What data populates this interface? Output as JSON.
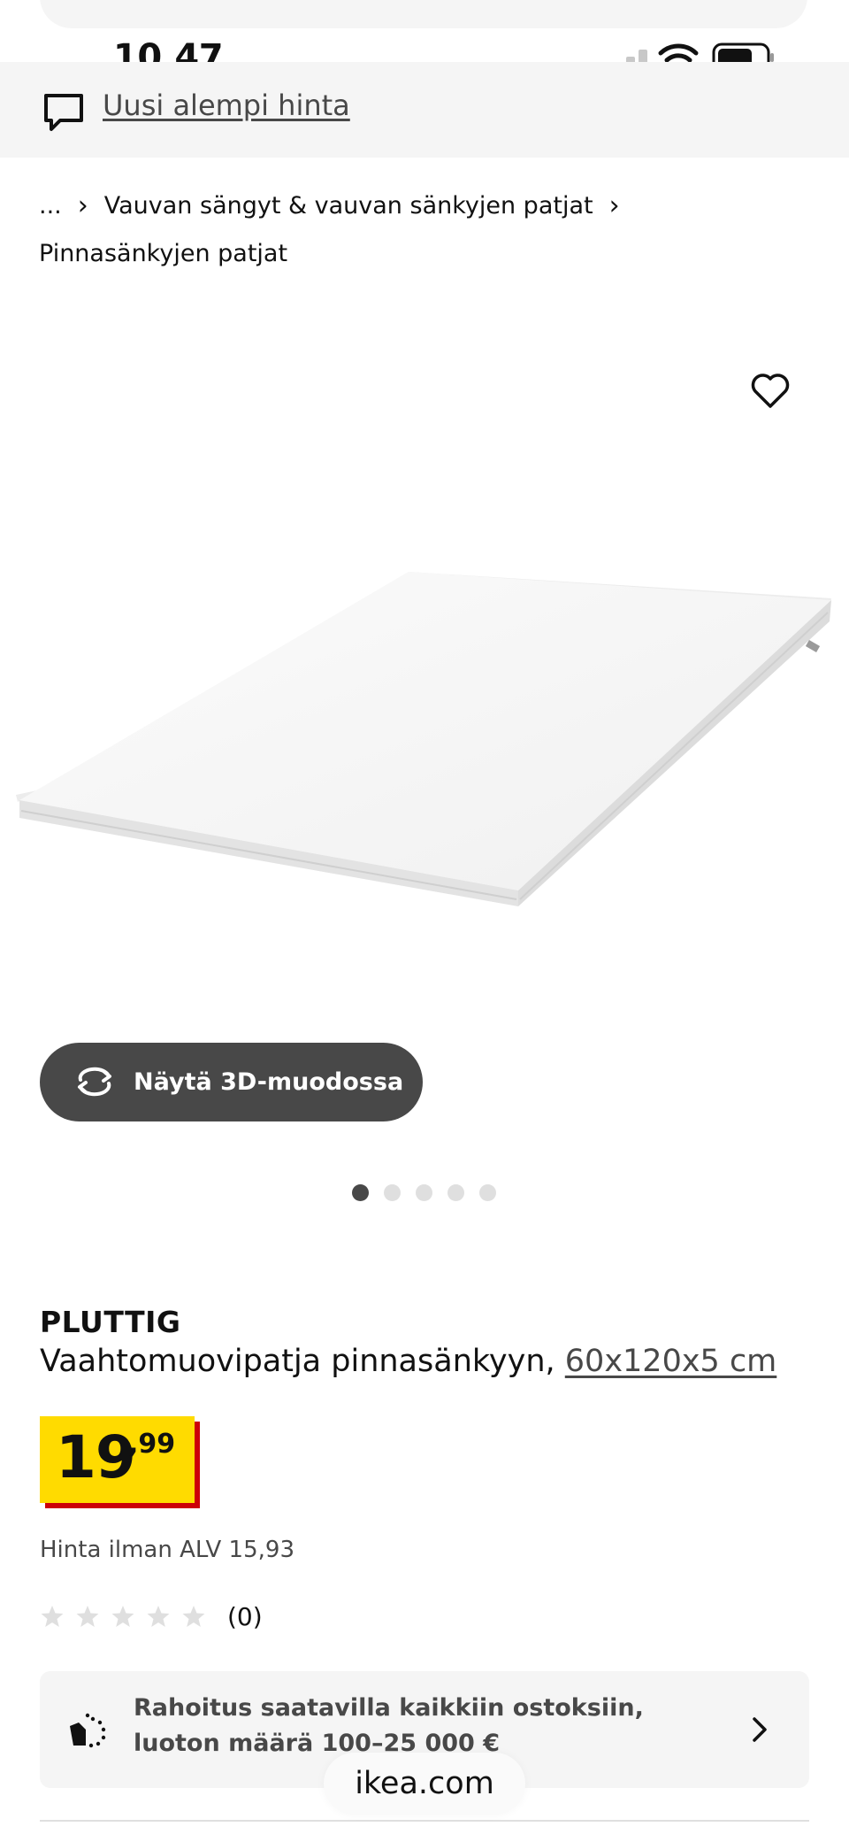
{
  "status_bar": {
    "time": "10.47"
  },
  "banner": {
    "icon": "chat-bubble-icon",
    "link_label": "Uusi alempi hinta"
  },
  "breadcrumb": {
    "ellipsis": "...",
    "items": [
      "Vauvan sängyt & vauvan sänkyjen patjat",
      "Pinnasänkyjen patjat"
    ]
  },
  "gallery": {
    "favorite_icon": "heart-icon",
    "view_3d_label": "Näytä 3D-muodossa",
    "view_3d_icon": "rotate-icon",
    "image_count": 5,
    "active_index": 0
  },
  "product": {
    "name": "PLUTTIG",
    "description": "Vaahtomuovipatja pinnasänkyyn,",
    "size": "60x120x5 cm",
    "price_integer": "19",
    "price_decimal": ",99",
    "price_excl_vat": "Hinta ilman ALV 15,93",
    "rating_value": 0,
    "rating_max": 5,
    "rating_count": "(0)"
  },
  "finance": {
    "icon": "financing-icon",
    "text": "Rahoitus saatavilla kaikkiin ostoksiin, luoton määrä 100–25 000 €"
  },
  "browser": {
    "url": "ikea.com"
  },
  "colors": {
    "price_yellow": "#ffdb00",
    "price_red": "#cc0008",
    "button_dark": "#484848",
    "panel_grey": "#f5f5f5"
  }
}
